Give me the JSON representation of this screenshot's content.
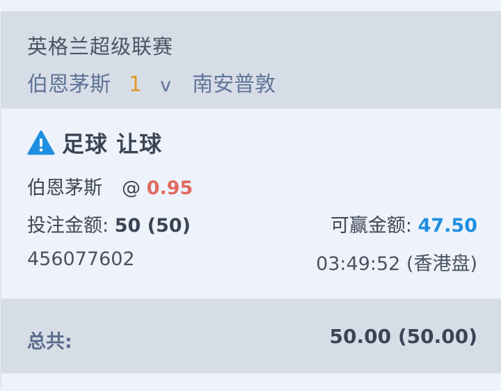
{
  "match": {
    "league": "英格兰超级联赛",
    "home_team": "伯恩茅斯",
    "score": "1",
    "vs": "v",
    "away_team": "南安普敦"
  },
  "bet": {
    "market": "足球 让球",
    "market_icon": "warning-icon",
    "selection": "伯恩茅斯",
    "at_symbol": "@",
    "odds": "0.95",
    "stake_label": "投注金额:",
    "stake_value": "50 (50)",
    "win_label": "可赢金额:",
    "win_value": "47.50",
    "ticket_id": "456077602",
    "time": "03:49:52 (香港盘)"
  },
  "total": {
    "label": "总共:",
    "value": "50.00 (50.00)"
  },
  "colors": {
    "header_bg": "#d7dde7",
    "body_bg": "#eef3fb",
    "score": "#e19a25",
    "odds": "#e06b5f",
    "win_amount": "#1e8fe0",
    "warning_icon": "#1e8fe0"
  }
}
